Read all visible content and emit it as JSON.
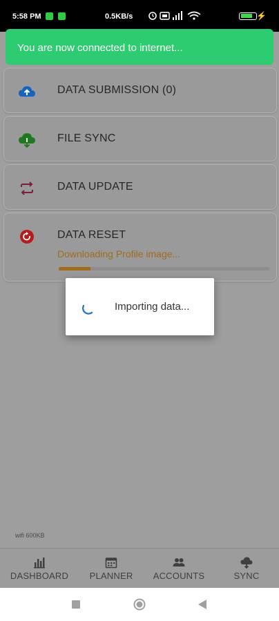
{
  "status_bar": {
    "time": "5:58 PM",
    "network_speed": "0.5KB/s",
    "battery": "89"
  },
  "toast": {
    "message": "You are now connected to internet..."
  },
  "sync_cards": [
    {
      "label": "DATA SUBMISSION (0)",
      "icon": "cloud-upload-icon",
      "icon_color": "#1565c0"
    },
    {
      "label": "FILE SYNC",
      "icon": "cloud-download-icon",
      "icon_color": "#1e7a1e"
    },
    {
      "label": "DATA UPDATE",
      "icon": "repeat-icon",
      "icon_color": "#7b1f3a"
    },
    {
      "label": "DATA RESET",
      "icon": "reset-icon",
      "icon_color": "#b71c1c",
      "status": "Downloading Profile image...",
      "progress": 0.15,
      "progress_color": "#a06c1a"
    }
  ],
  "dialog": {
    "message": "Importing data..."
  },
  "net_speed_label": "wifi 600KB",
  "bottom_nav": [
    {
      "label": "DASHBOARD",
      "icon": "bar-chart-icon"
    },
    {
      "label": "PLANNER",
      "icon": "calendar-icon"
    },
    {
      "label": "ACCOUNTS",
      "icon": "people-icon"
    },
    {
      "label": "SYNC",
      "icon": "cloud-sync-icon"
    }
  ],
  "system_nav": [
    {
      "icon": "recents-square-icon"
    },
    {
      "icon": "home-circle-icon"
    },
    {
      "icon": "back-triangle-icon"
    }
  ]
}
